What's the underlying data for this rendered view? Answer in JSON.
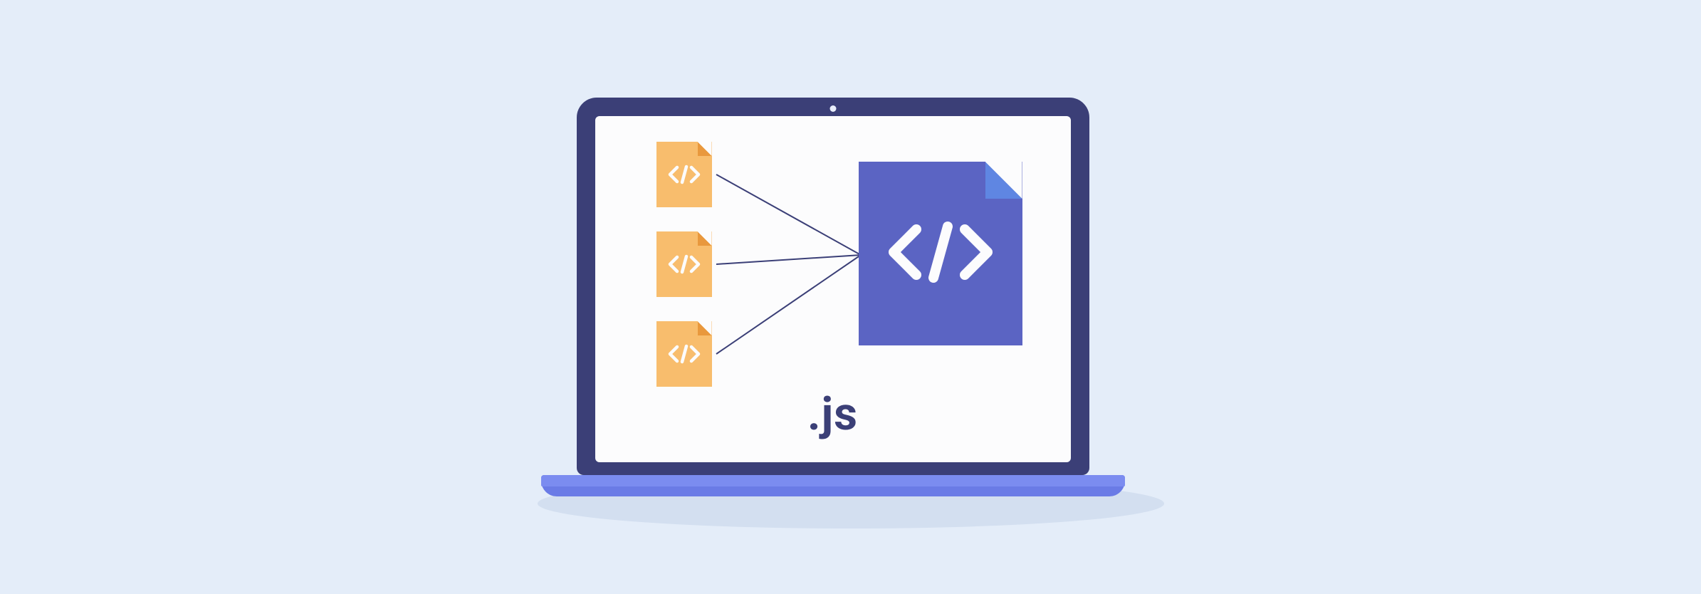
{
  "diagram": {
    "extension_label": ".js",
    "source_files_count": 3,
    "source_file_icon": "code-brackets-icon",
    "bundle_file_icon": "code-brackets-icon",
    "concept": "bundling multiple source files into one JavaScript file"
  },
  "colors": {
    "page_bg": "#e4edf9",
    "laptop_frame": "#3b3f77",
    "laptop_base_light": "#7b8cf0",
    "laptop_base_dark": "#6a7be6",
    "screen_bg": "#fcfcfd",
    "source_file_bg": "#f8bd6d",
    "source_file_fold": "#e9983d",
    "bundle_file_bg": "#5b64c3",
    "bundle_file_fold": "#5f86e2",
    "shadow": "#d3dff0"
  }
}
